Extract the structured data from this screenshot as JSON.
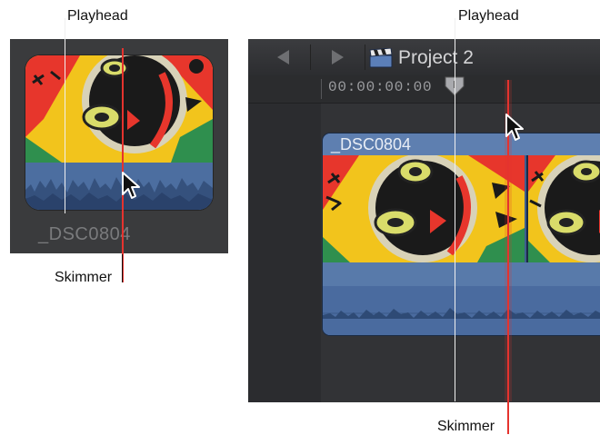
{
  "callouts": {
    "left_playhead": "Playhead",
    "left_skimmer": "Skimmer",
    "right_playhead": "Playhead",
    "right_skimmer": "Skimmer"
  },
  "browser": {
    "clip_name": "_DSC0804"
  },
  "timeline": {
    "project_title": "Project 2",
    "timecode": "00:00:00:00",
    "clip_name": "_DSC0804"
  },
  "colors": {
    "skimmer": "#e5332e",
    "playhead": "#f0f0f0",
    "clip_blue": "#4a6b9f"
  },
  "icons": [
    "back-arrow-icon",
    "forward-arrow-icon",
    "clapperboard-icon",
    "pointer-cursor-icon",
    "playhead-handle-icon"
  ]
}
